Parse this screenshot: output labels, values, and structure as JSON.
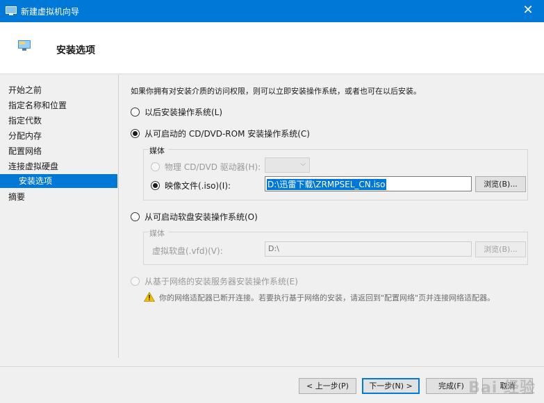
{
  "window": {
    "title": "新建虚拟机向导",
    "close_glyph": "✕"
  },
  "header": {
    "title": "安装选项"
  },
  "sidebar": {
    "items": [
      {
        "label": "开始之前"
      },
      {
        "label": "指定名称和位置"
      },
      {
        "label": "指定代数"
      },
      {
        "label": "分配内存"
      },
      {
        "label": "配置网络"
      },
      {
        "label": "连接虚拟硬盘"
      },
      {
        "label": "安装选项",
        "active": true
      },
      {
        "label": "摘要"
      }
    ]
  },
  "main": {
    "description": "如果你拥有对安装介质的访问权限，则可以立即安装操作系统，或者也可在以后安装。",
    "option_later": "以后安装操作系统(L)",
    "option_cd": "从可启动的 CD/DVD-ROM 安装操作系统(C)",
    "cd_group": {
      "title": "媒体",
      "physical_label": "物理 CD/DVD 驱动器(H):",
      "image_label": "映像文件(.iso)(I):",
      "image_value": "D:\\迅雷下载\\ZRMPSEL_CN.iso",
      "browse_label": "浏览(B)..."
    },
    "option_floppy": "从可启动软盘安装操作系统(O)",
    "floppy_group": {
      "title": "媒体",
      "vfd_label": "虚拟软盘(.vfd)(V):",
      "vfd_value": "D:\\",
      "browse_label": "浏览(B)..."
    },
    "option_network": "从基于网络的安装服务器安装操作系统(E)",
    "network_warning": "你的网络适配器已断开连接。若要执行基于网络的安装，请返回到\"配置网络\"页并连接网络适配器。"
  },
  "footer": {
    "prev": "< 上一步(P)",
    "next": "下一步(N) >",
    "finish": "完成(F)",
    "cancel": "取消"
  },
  "watermark": "Bai 经验",
  "colors": {
    "accent": "#0078d7",
    "warning": "#f2c200"
  }
}
